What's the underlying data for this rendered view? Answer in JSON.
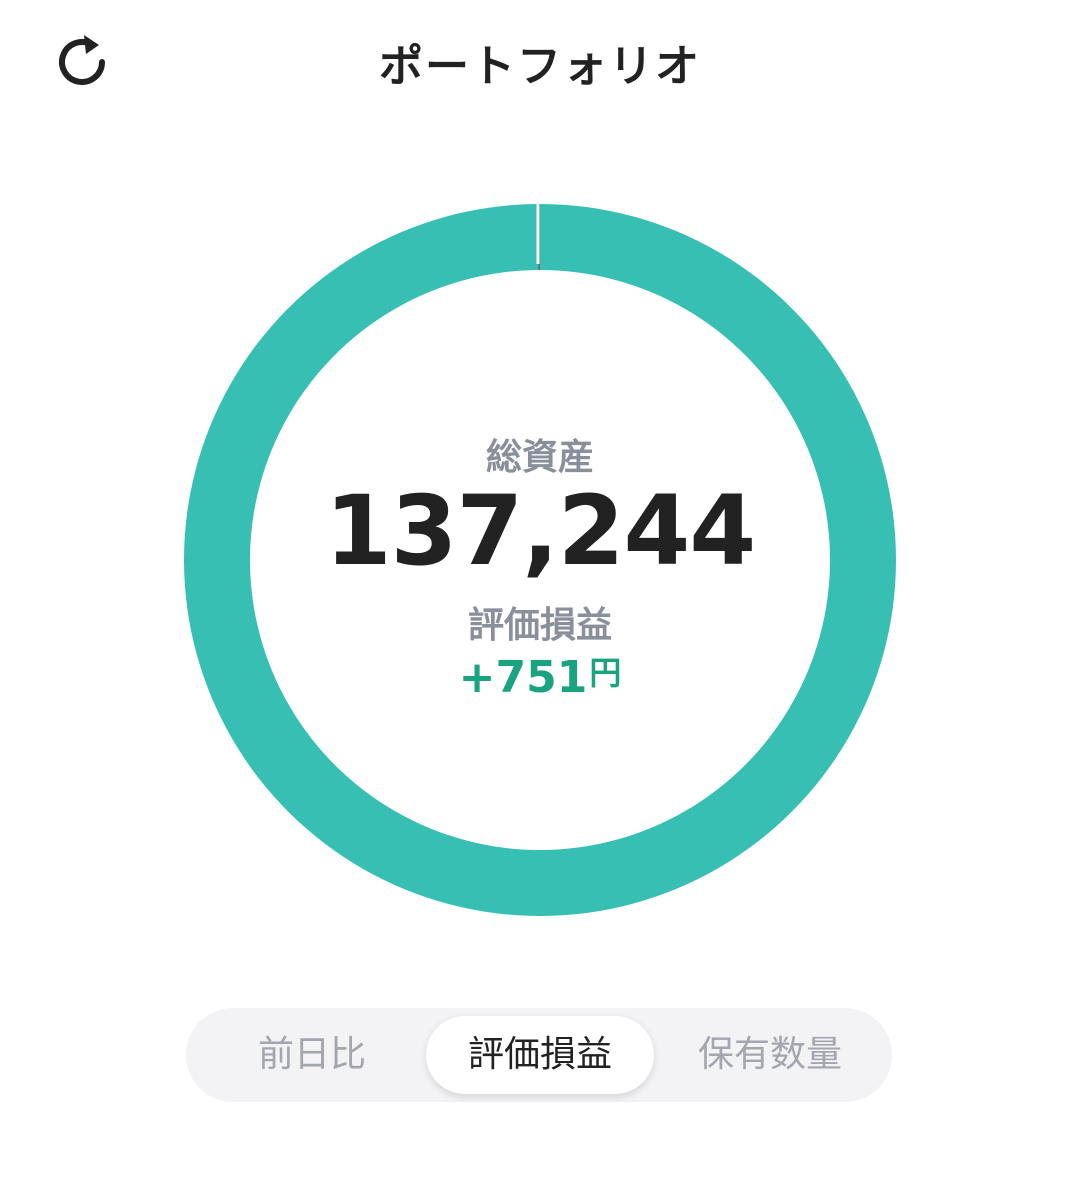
{
  "header": {
    "title": "ポートフォリオ",
    "refresh_icon": "refresh-icon"
  },
  "colors": {
    "accent": "#38bfb3",
    "positive": "#1aa380",
    "muted_label": "#8a8f9c",
    "divider": "#5f6a75"
  },
  "summary": {
    "total_label": "総資産",
    "total_value": "137,244",
    "pl_label": "評価損益",
    "pl_value": "+751",
    "pl_unit": "円"
  },
  "chart_data": {
    "type": "pie",
    "segments": [
      {
        "value": 99.9,
        "color": "#38bfb3"
      },
      {
        "value": 0.1,
        "color": "#5f6a75"
      }
    ]
  },
  "segmented": {
    "items": [
      {
        "label": "前日比",
        "active": false
      },
      {
        "label": "評価損益",
        "active": true
      },
      {
        "label": "保有数量",
        "active": false
      }
    ]
  }
}
